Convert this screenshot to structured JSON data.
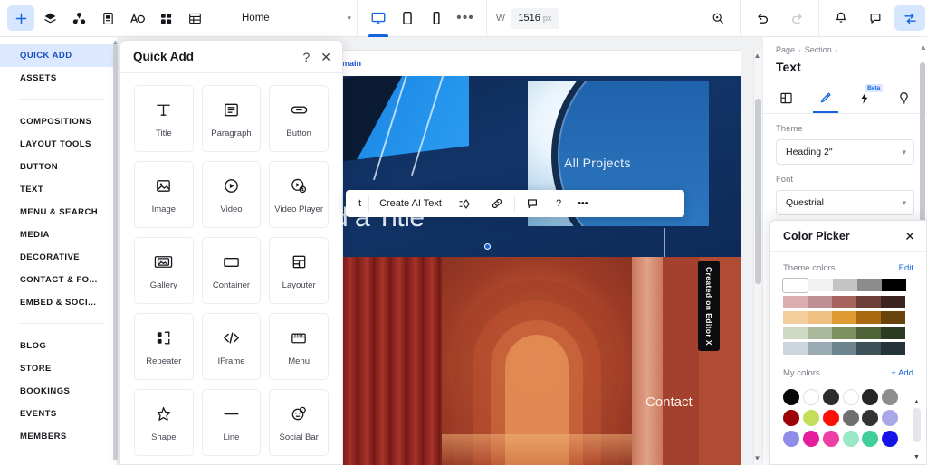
{
  "topbar": {
    "left_tools": [
      {
        "name": "add-elements-icon",
        "label": "Add"
      },
      {
        "name": "layers-icon",
        "label": "Layers"
      },
      {
        "name": "site-structure-icon",
        "label": "Site Structure"
      },
      {
        "name": "pages-icon",
        "label": "Pages"
      },
      {
        "name": "text-styles-icon",
        "label": "Text Styles"
      },
      {
        "name": "apps-icon",
        "label": "Apps"
      },
      {
        "name": "cms-icon",
        "label": "CMS"
      }
    ],
    "page_select": {
      "value": "Home",
      "chevron": "▾"
    },
    "devices": [
      {
        "name": "desktop",
        "label": "Desktop",
        "active": true
      },
      {
        "name": "tablet",
        "label": "Tablet",
        "active": false
      },
      {
        "name": "mobile",
        "label": "Mobile",
        "active": false
      }
    ],
    "more_label": "•••",
    "width": {
      "label": "W",
      "value": "1516",
      "unit": "px"
    },
    "right_tools": [
      {
        "name": "zoom-icon",
        "label": "Zoom"
      },
      {
        "name": "undo-icon",
        "label": "Undo"
      },
      {
        "name": "redo-icon",
        "label": "Redo"
      },
      {
        "name": "notifications-icon",
        "label": "Notifications"
      },
      {
        "name": "comments-icon",
        "label": "Comments"
      },
      {
        "name": "settings-toggles-icon",
        "label": "Tools"
      }
    ]
  },
  "rail": {
    "group1": [
      {
        "label": "QUICK ADD",
        "active": true
      },
      {
        "label": "ASSETS",
        "active": false
      }
    ],
    "group2": [
      {
        "label": "COMPOSITIONS"
      },
      {
        "label": "LAYOUT TOOLS"
      },
      {
        "label": "BUTTON"
      },
      {
        "label": "TEXT"
      },
      {
        "label": "MENU & SEARCH"
      },
      {
        "label": "MEDIA"
      },
      {
        "label": "DECORATIVE"
      },
      {
        "label": "CONTACT & FO..."
      },
      {
        "label": "EMBED & SOCI..."
      }
    ],
    "group3": [
      {
        "label": "BLOG"
      },
      {
        "label": "STORE"
      },
      {
        "label": "BOOKINGS"
      },
      {
        "label": "EVENTS"
      },
      {
        "label": "MEMBERS"
      }
    ]
  },
  "quick_add": {
    "title": "Quick Add",
    "help_label": "?",
    "close_label": "✕",
    "items": [
      {
        "label": "Title",
        "icon": "title-icon"
      },
      {
        "label": "Paragraph",
        "icon": "paragraph-icon"
      },
      {
        "label": "Button",
        "icon": "button-icon"
      },
      {
        "label": "Image",
        "icon": "image-icon"
      },
      {
        "label": "Video",
        "icon": "video-icon"
      },
      {
        "label": "Video Player",
        "icon": "video-player-icon"
      },
      {
        "label": "Gallery",
        "icon": "gallery-icon"
      },
      {
        "label": "Container",
        "icon": "container-icon"
      },
      {
        "label": "Layouter",
        "icon": "layouter-icon"
      },
      {
        "label": "Repeater",
        "icon": "repeater-icon"
      },
      {
        "label": "IFrame",
        "icon": "iframe-icon"
      },
      {
        "label": "Menu",
        "icon": "menu-icon"
      },
      {
        "label": "Shape",
        "icon": "shape-icon"
      },
      {
        "label": "Line",
        "icon": "line-icon"
      },
      {
        "label": "Social Bar",
        "icon": "social-bar-icon"
      }
    ]
  },
  "canvas": {
    "domain_text": "main",
    "hero_title": "d a Title",
    "all_projects_label": "All Projects",
    "contact_label": "Contact",
    "editorx_badge": "Created on Editor X",
    "float_toolbar": {
      "left_fragment": "t",
      "create_ai_text": "Create AI Text",
      "items": [
        {
          "name": "ai-sparkle-icon",
          "label": "AI"
        },
        {
          "name": "link-icon",
          "label": "Link"
        },
        {
          "name": "comment-icon",
          "label": "Comment"
        },
        {
          "name": "help-icon",
          "label": "?"
        },
        {
          "name": "more-icon",
          "label": "•••"
        }
      ]
    }
  },
  "right_panel": {
    "breadcrumb": [
      "Page",
      "Section"
    ],
    "breadcrumb_sep": "›",
    "title": "Text",
    "tabs": [
      {
        "name": "layout-tab",
        "label": "Layout",
        "active": false,
        "badge": ""
      },
      {
        "name": "design-tab",
        "label": "Design",
        "active": true,
        "badge": ""
      },
      {
        "name": "ai-tab",
        "label": "AI",
        "active": false,
        "badge": "Beta"
      },
      {
        "name": "tips-tab",
        "label": "Tips",
        "active": false,
        "badge": ""
      }
    ],
    "theme": {
      "label": "Theme",
      "value": "Heading 2\"",
      "chevron": "▾"
    },
    "font": {
      "label": "Font",
      "value": "Questrial",
      "chevron": "▾"
    }
  },
  "color_picker": {
    "title": "Color Picker",
    "close_label": "✕",
    "theme_colors_label": "Theme colors",
    "edit_label": "Edit",
    "theme_rows": [
      [
        "#ffffff",
        "#f1f1f1",
        "#c4c4c4",
        "#8c8c8c",
        "#000000"
      ],
      [
        "#dcaeb0",
        "#bc8f95",
        "#a8655f",
        "#6e3e39",
        "#3c2421"
      ],
      [
        "#f5cf9b",
        "#eec183",
        "#df9a34",
        "#a9690f",
        "#68430c"
      ],
      [
        "#cfd9c4",
        "#aab89b",
        "#7d9160",
        "#4e6238",
        "#2d3a22"
      ],
      [
        "#ccd6dc",
        "#99aab3",
        "#6d858f",
        "#3d5159",
        "#24343a"
      ]
    ],
    "my_colors_label": "My colors",
    "add_label": "+ Add",
    "my_colors": [
      "#080808",
      "#ffffff",
      "#2c2c2c",
      "#ffffff",
      "#262626",
      "#8e8e8e",
      "#9c0309",
      "#c3de59",
      "#fb1105",
      "#6f6f6f",
      "#333333",
      "#a8a8e8",
      "#8e8eea",
      "#e51d9c",
      "#ef3fa5",
      "#9ae8c6",
      "#3ecf9a",
      "#1414e8"
    ]
  }
}
